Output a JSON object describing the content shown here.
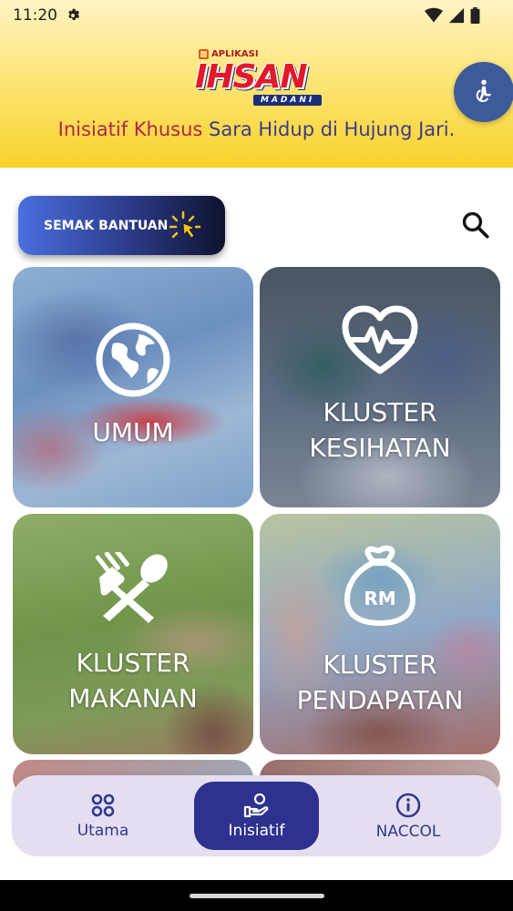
{
  "status_bar": {
    "time": "11:20"
  },
  "header": {
    "logo_small": "APLIKASI",
    "logo_main": "IHSAN",
    "logo_sub": "MADANI",
    "tagline_part1": "Inisiatif Khusus",
    "tagline_part2": " Sara Hidup di Hujung Jari.",
    "accessibility_icon": "accessibility-icon"
  },
  "actions": {
    "semak_label": "SEMAK BANTUAN",
    "semak_icon": "sparkle-cursor-icon",
    "search_icon": "search-icon"
  },
  "cards": [
    {
      "title_line1": "UMUM",
      "title_line2": "",
      "icon": "globe-icon"
    },
    {
      "title_line1": "KLUSTER",
      "title_line2": "KESIHATAN",
      "icon": "heartbeat-icon"
    },
    {
      "title_line1": "KLUSTER",
      "title_line2": "MAKANAN",
      "icon": "fork-spoon-icon"
    },
    {
      "title_line1": "KLUSTER",
      "title_line2": "PENDAPATAN",
      "icon": "money-bag-icon",
      "icon_text": "RM"
    }
  ],
  "bottom_nav": [
    {
      "label": "Utama",
      "icon": "grid-icon",
      "active": false
    },
    {
      "label": "Inisiatif",
      "icon": "hand-person-icon",
      "active": true
    },
    {
      "label": "NACCOL",
      "icon": "info-icon",
      "active": false
    }
  ],
  "colors": {
    "header_yellow": "#f8d22a",
    "brand_navy": "#2e318f",
    "tagline_red": "#b0264d",
    "tagline_blue": "#3a3a8c",
    "nav_bg": "#e5def0"
  }
}
